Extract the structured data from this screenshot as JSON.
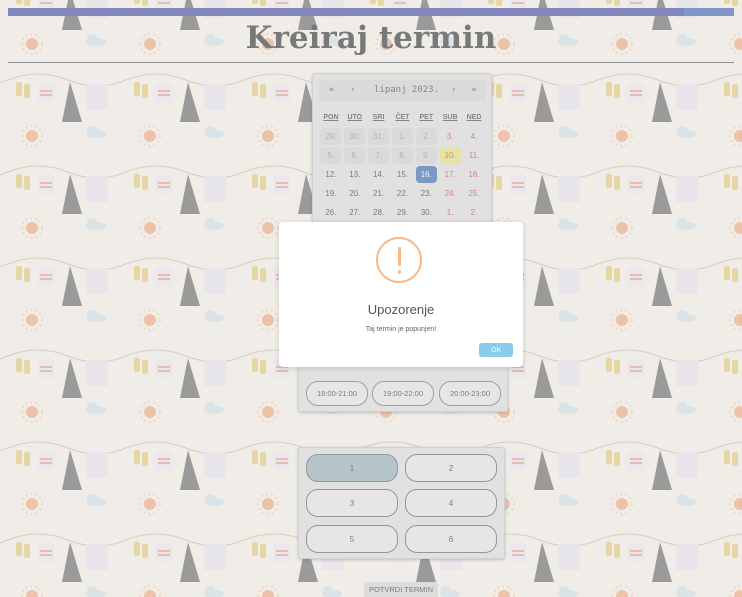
{
  "app": {
    "title": "Kreiraj termin"
  },
  "calendar": {
    "month_label": "lipanj 2023.",
    "nav": {
      "prev_year": "«",
      "prev_month": "‹",
      "next_month": "›",
      "next_year": "»"
    },
    "weekdays": [
      "PON",
      "UTO",
      "SRI",
      "ČET",
      "PET",
      "SUB",
      "NED"
    ],
    "weeks": [
      [
        "29.",
        "30.",
        "31.",
        "1.",
        "2.",
        "3.",
        "4."
      ],
      [
        "5.",
        "6.",
        "7.",
        "8.",
        "9.",
        "10.",
        "11."
      ],
      [
        "12.",
        "13.",
        "14.",
        "15.",
        "16.",
        "17.",
        "18."
      ],
      [
        "19.",
        "20.",
        "21.",
        "22.",
        "23.",
        "24.",
        "25."
      ],
      [
        "26.",
        "27.",
        "28.",
        "29.",
        "30.",
        "1.",
        "2."
      ]
    ],
    "selected_day": "16.",
    "today_day": "10."
  },
  "time_slots": [
    "18:00-21:00",
    "19:00-22:00",
    "20:00-23:00"
  ],
  "persons": {
    "options": [
      "1",
      "2",
      "3",
      "4",
      "5",
      "6"
    ],
    "selected": "1"
  },
  "confirm_label": "POTVRDI TERMIN",
  "modal": {
    "title": "Upozorenje",
    "message": "Taj termin je popunjen!",
    "ok_label": "OK"
  },
  "colors": {
    "accent": "#2f3a96",
    "selected": "#1f5aa3",
    "today": "#e8e06a",
    "warning": "#f6b987",
    "ok_button": "#8bcbed"
  }
}
